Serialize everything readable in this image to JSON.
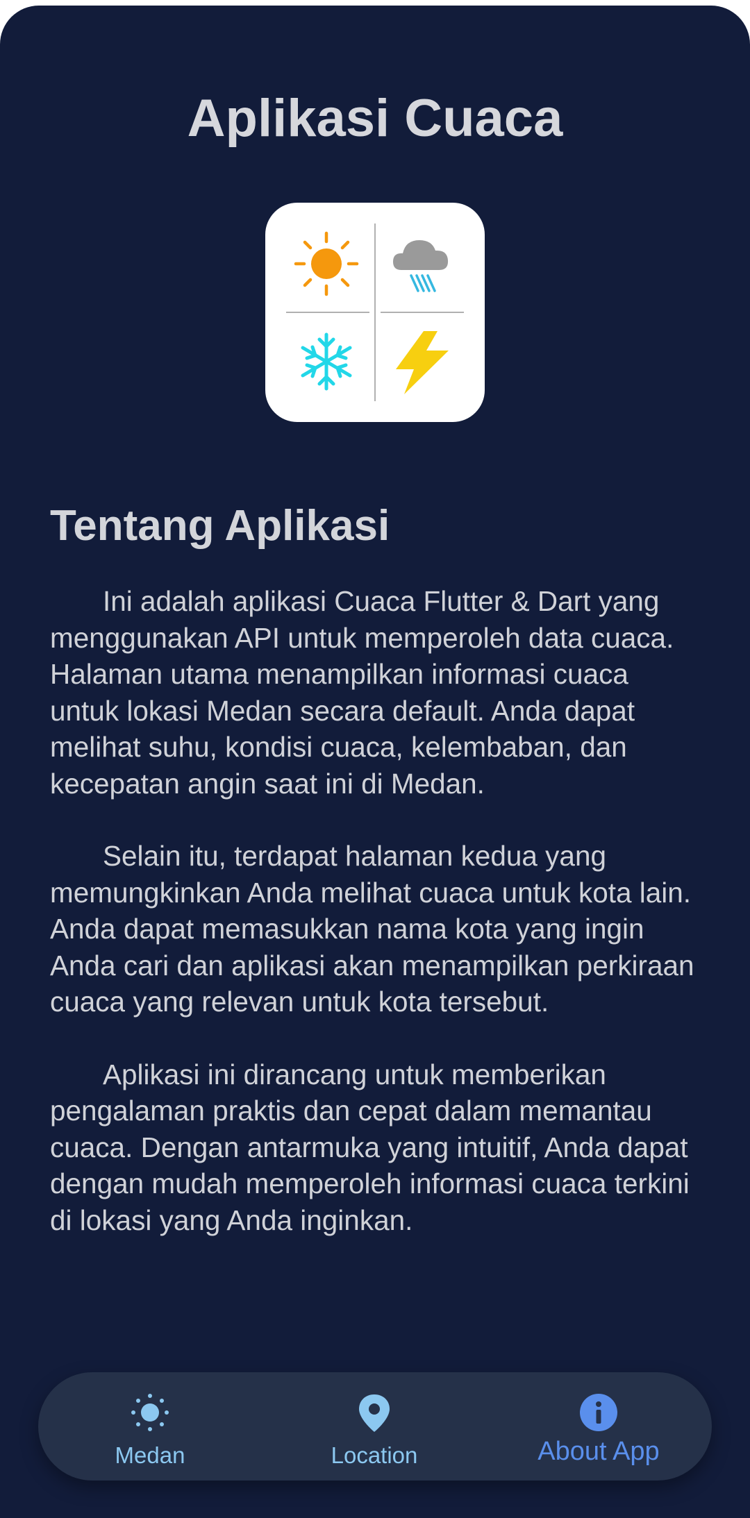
{
  "app": {
    "title": "Aplikasi Cuaca"
  },
  "logo": {
    "icons": [
      "sun-icon",
      "rain-cloud-icon",
      "snowflake-icon",
      "lightning-icon"
    ],
    "colors": {
      "sun": "#f5980d",
      "cloud": "#9a9a9a",
      "rain": "#35b8e0",
      "snow": "#22d7e8",
      "lightning": "#f7cf10"
    }
  },
  "about": {
    "heading": "Tentang Aplikasi",
    "paragraphs": [
      "Ini adalah aplikasi Cuaca Flutter & Dart yang menggunakan API untuk memperoleh data cuaca. Halaman utama menampilkan informasi cuaca untuk lokasi Medan secara default. Anda dapat melihat suhu, kondisi cuaca, kelembaban, dan kecepatan angin saat ini di Medan.",
      "Selain itu, terdapat halaman kedua yang memungkinkan Anda melihat cuaca untuk kota lain. Anda dapat memasukkan nama kota yang ingin Anda cari dan aplikasi akan menampilkan perkiraan cuaca yang relevan untuk kota tersebut.",
      "Aplikasi ini dirancang untuk memberikan pengalaman praktis dan cepat dalam memantau cuaca. Dengan antarmuka yang intuitif, Anda dapat dengan mudah memperoleh informasi cuaca terkini di lokasi yang Anda inginkan."
    ]
  },
  "bottom_nav": {
    "items": [
      {
        "label": "Medan",
        "icon": "sun-icon",
        "selected": false
      },
      {
        "label": "Location",
        "icon": "location-pin-icon",
        "selected": false
      },
      {
        "label": "About App",
        "icon": "info-icon",
        "selected": true
      }
    ],
    "colors": {
      "background": "#253149",
      "inactive": "#8cc8f0",
      "active": "#5a8fec"
    }
  },
  "colors": {
    "background": "#121c3a",
    "text": "#d0d2d8"
  }
}
